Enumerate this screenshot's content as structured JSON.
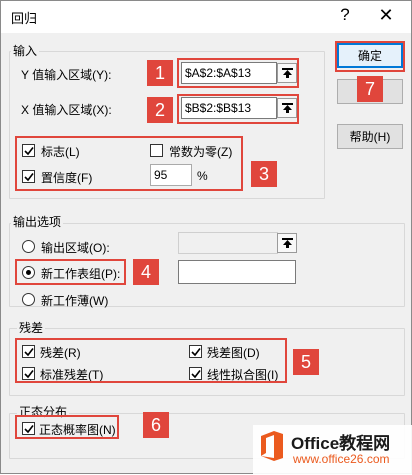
{
  "window": {
    "title": "回归",
    "help_glyph": "?",
    "close_glyph": "✕"
  },
  "input_group": {
    "label": "输入",
    "y_label": "Y 值输入区域(Y):",
    "y_value": "$A$2:$A$13",
    "x_label": "X 值输入区域(X):",
    "x_value": "$B$2:$B$13",
    "labels_checkbox": {
      "label": "标志(L)",
      "checked": true
    },
    "constant_zero_checkbox": {
      "label": "常数为零(Z)",
      "checked": false
    },
    "confidence_checkbox": {
      "label": "置信度(F)",
      "checked": true
    },
    "confidence_value": "95",
    "confidence_unit": "%"
  },
  "buttons": {
    "ok": "确定",
    "cancel": "",
    "help": "帮助(H)"
  },
  "output_group": {
    "label": "输出选项",
    "output_range": {
      "label": "输出区域(O):",
      "selected": false,
      "value": ""
    },
    "new_worksheet_ply": {
      "label": "新工作表组(P):",
      "selected": true,
      "value": ""
    },
    "new_workbook": {
      "label": "新工作薄(W)",
      "selected": false
    }
  },
  "residuals_group": {
    "label": "残差",
    "residuals": {
      "label": "残差(R)",
      "checked": true
    },
    "residual_plots": {
      "label": "残差图(D)",
      "checked": true
    },
    "standardized_residuals": {
      "label": "标准残差(T)",
      "checked": true
    },
    "line_fit_plots": {
      "label": "线性拟合图(I)",
      "checked": true
    }
  },
  "normal_group": {
    "label": "正态分布",
    "normal_probability_plots": {
      "label": "正态概率图(N)",
      "checked": true
    }
  },
  "callouts": [
    "1",
    "2",
    "3",
    "4",
    "5",
    "6",
    "7"
  ],
  "watermark": {
    "brand": "Office教程网",
    "url": "www.office26.com",
    "logo": "office-logo"
  },
  "colors": {
    "callout": "#e0463c",
    "default_button_border": "#0078d7",
    "logo_orange": "#eb5a1e",
    "brand_text": "#1a1a1a"
  }
}
